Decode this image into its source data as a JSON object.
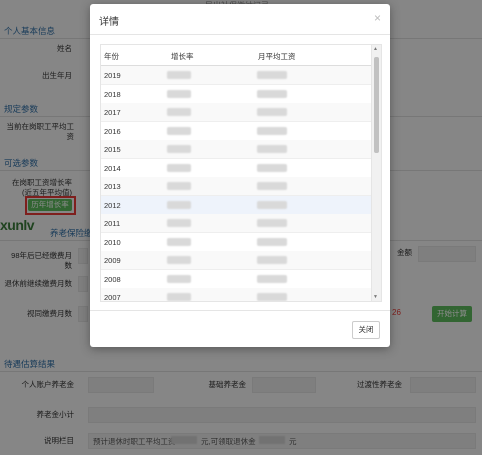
{
  "background": {
    "top_title": "导出社保缴纳记录",
    "sections": {
      "basic": "个人基本信息",
      "regulation": "规定参数",
      "optional": "可选参数",
      "pension_basis": "养老保险缴费基数",
      "results": "待遇估算结果"
    },
    "labels": {
      "name": "姓名",
      "birth": "出生年月",
      "avg_wage": "当前在岗职工平均工资",
      "avg_wage_growth": "在岗职工资增长率(近五年平均值)",
      "history_button": "历年增长率",
      "paid_months_98": "98年后已经缴费月数",
      "months_before_retire": "退休前继续缴费月数",
      "deemed_months": "视同缴费月数",
      "calc_button": "开始计算",
      "personal_account": "个人账户养老金",
      "basic_pension": "基础养老金",
      "transitional": "过渡性养老金",
      "subtotal": "养老金小计",
      "notes": "说明栏目",
      "notes_text": "预计退休时职工平均工资",
      "note_yuan": "元,可领取退休金",
      "note_yuan2": "元",
      "base_amount": "金额",
      "red_value": "26"
    },
    "watermark": "xunlv"
  },
  "modal": {
    "title": "详情",
    "close_icon": "×",
    "columns": [
      "年份",
      "增长率",
      "月平均工资"
    ],
    "years": [
      "2019",
      "2018",
      "2017",
      "2016",
      "2015",
      "2014",
      "2013",
      "2012",
      "2011",
      "2010",
      "2009",
      "2008",
      "2007"
    ],
    "close_button": "关闭"
  },
  "colors": {
    "accent": "#2e6da4",
    "green": "#5cb85c",
    "red": "#e53935"
  }
}
